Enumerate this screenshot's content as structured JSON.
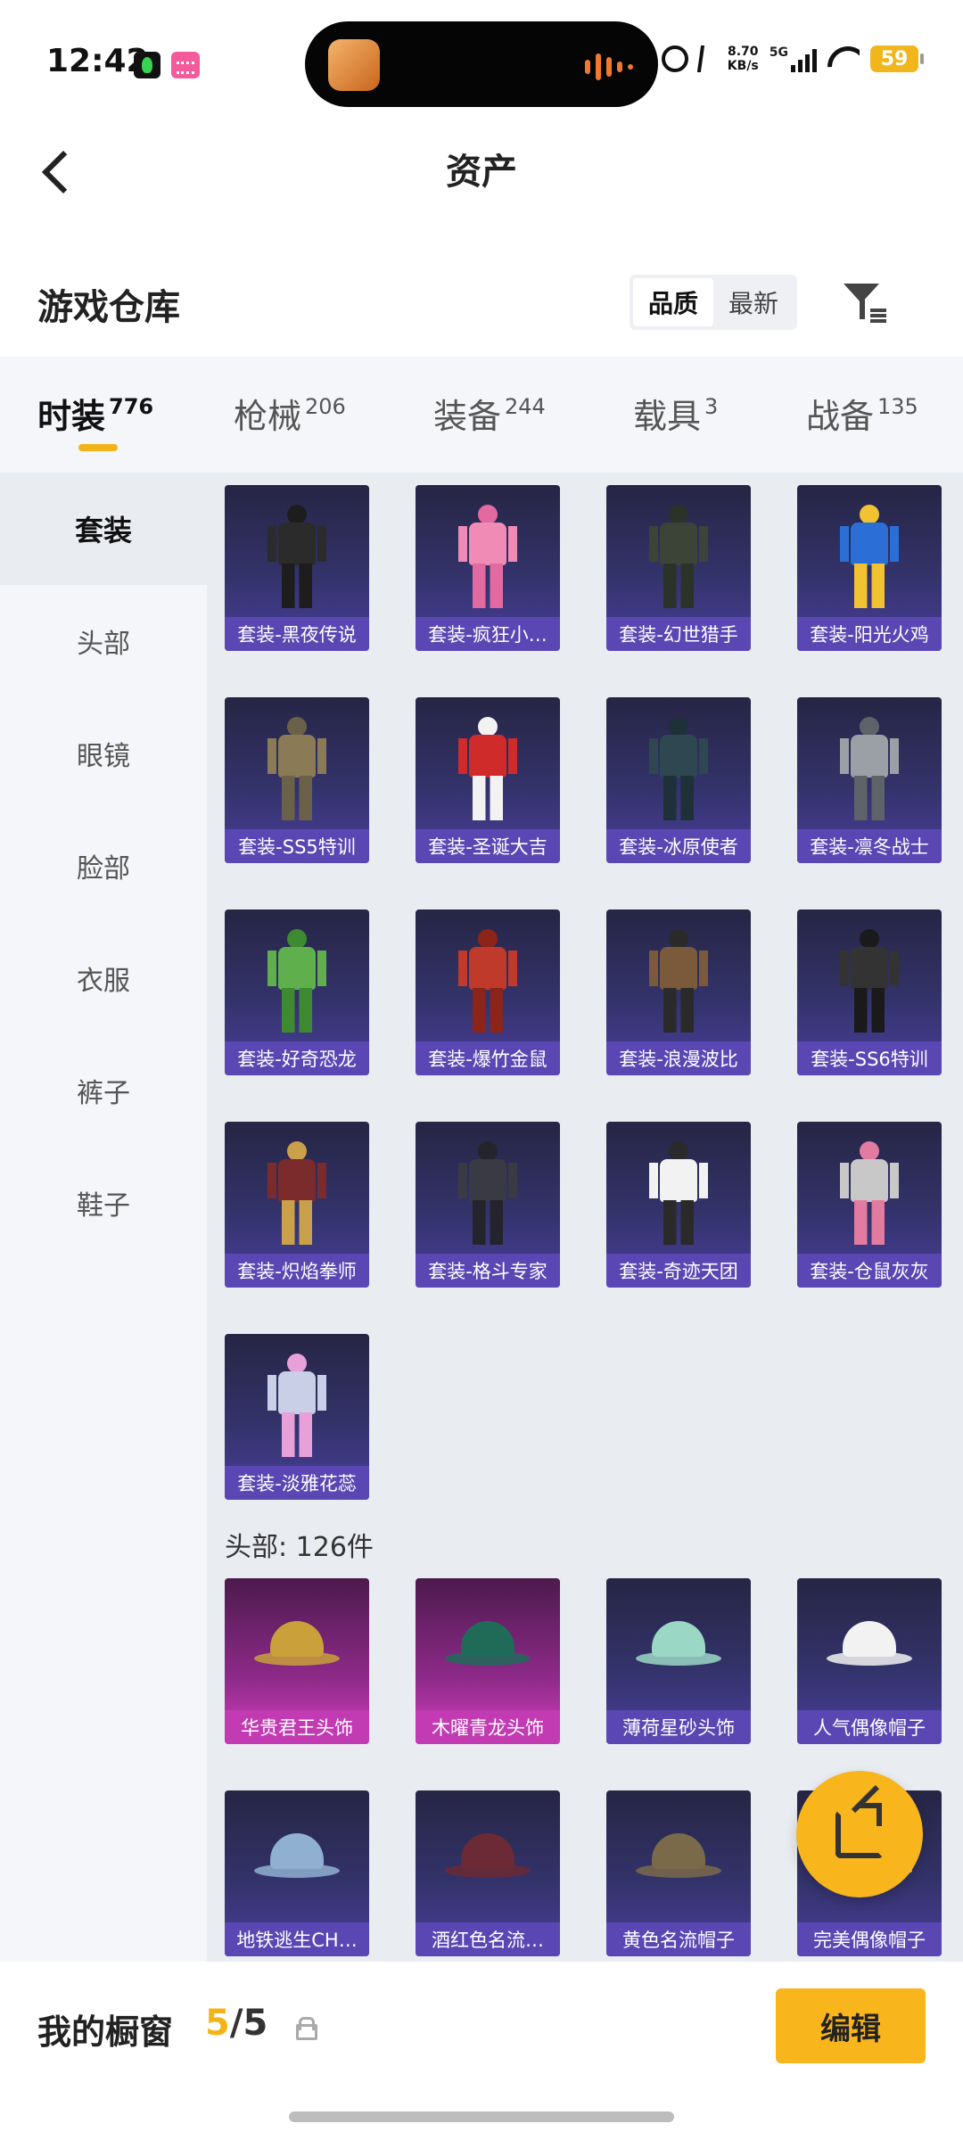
{
  "status_bar": {
    "time": "12:42",
    "net_speed_value": "8.70",
    "net_speed_unit": "KB/s",
    "network": "5G",
    "battery": "59"
  },
  "header": {
    "title": "资产"
  },
  "warehouse": {
    "title": "游戏仓库",
    "sort_options": [
      "品质",
      "最新"
    ],
    "active_sort": "品质"
  },
  "category_tabs": [
    {
      "label": "时装",
      "count": "776",
      "active": true
    },
    {
      "label": "枪械",
      "count": "206"
    },
    {
      "label": "装备",
      "count": "244"
    },
    {
      "label": "载具",
      "count": "3"
    },
    {
      "label": "战备",
      "count": "135"
    }
  ],
  "left_nav": [
    "套装",
    "头部",
    "眼镜",
    "脸部",
    "衣服",
    "裤子",
    "鞋子"
  ],
  "suit_items": [
    "套装-黑夜传说",
    "套装-疯狂小…",
    "套装-幻世猎手",
    "套装-阳光火鸡",
    "套装-SS5特训",
    "套装-圣诞大吉",
    "套装-冰原使者",
    "套装-凛冬战士",
    "套装-好奇恐龙",
    "套装-爆竹金鼠",
    "套装-浪漫波比",
    "套装-SS6特训",
    "套装-炽焰拳师",
    "套装-格斗专家",
    "套装-奇迹天团",
    "套装-仓鼠灰灰",
    "套装-淡雅花蕊"
  ],
  "head_section_label": "头部: 126件",
  "head_items": [
    "华贵君王头饰",
    "木曜青龙头饰",
    "薄荷星砂头饰",
    "人气偶像帽子",
    "地铁逃生CH…",
    "酒红色名流…",
    "黄色名流帽子",
    "完美偶像帽子"
  ],
  "bottom_bar": {
    "label": "我的橱窗",
    "current": "5",
    "separator": "/",
    "max": "5",
    "edit_label": "编辑"
  },
  "colors": {
    "accent": "#f8b51c",
    "card_purple": "#5b47b4",
    "card_pink": "#c23bb3"
  }
}
